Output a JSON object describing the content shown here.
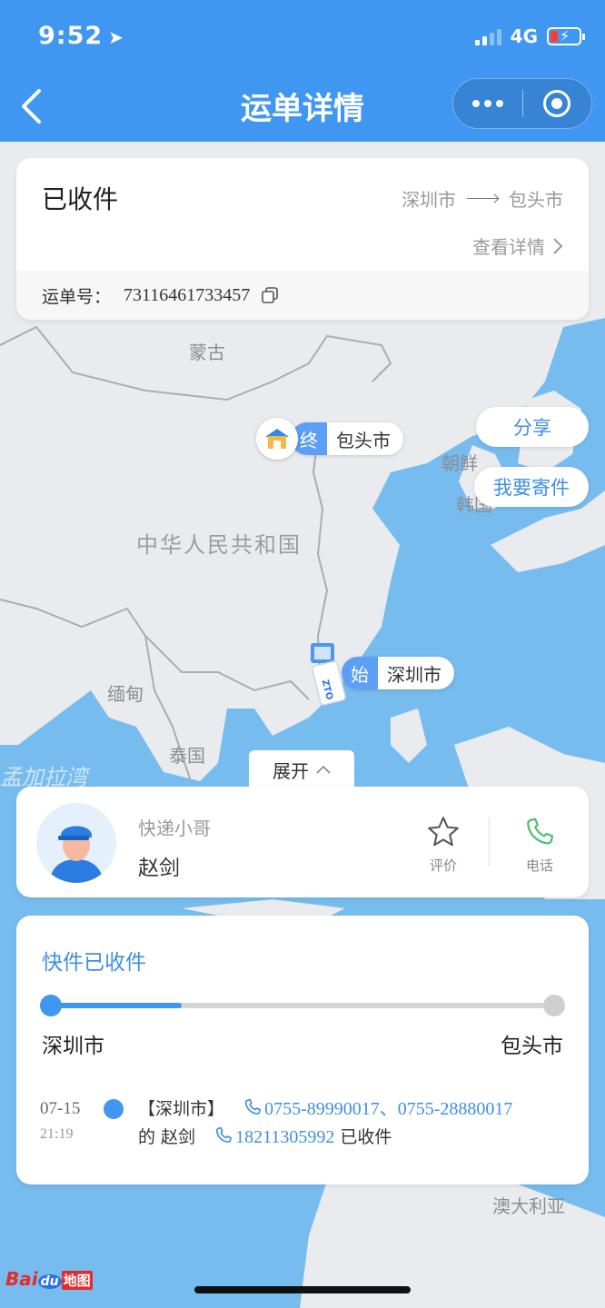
{
  "status_bar": {
    "time": "9:52",
    "network": "4G"
  },
  "nav": {
    "title": "运单详情"
  },
  "order": {
    "status": "已收件",
    "origin": "深圳市",
    "destination": "包头市",
    "detail_link": "查看详情",
    "waybill_label": "运单号：",
    "waybill_number": "73116461733457"
  },
  "map": {
    "labels": {
      "mongolia": "蒙古",
      "china": "中华人民共和国",
      "myanmar": "缅甸",
      "thailand": "泰国",
      "korea_north": "朝鲜",
      "korea_south": "韩国",
      "bay": "孟加拉湾",
      "australia": "澳大利亚"
    },
    "end_marker": {
      "tag": "终",
      "city": "包头市"
    },
    "start_marker": {
      "tag": "始",
      "city": "深圳市"
    },
    "share_button": "分享",
    "send_button": "我要寄件",
    "expand_label": "展开",
    "logo_text": "Bai",
    "logo_du": "du",
    "logo_map": "地图"
  },
  "courier": {
    "role": "快递小哥",
    "name": "赵剑",
    "rate_label": "评价",
    "call_label": "电话"
  },
  "progress": {
    "title": "快件已收件",
    "from": "深圳市",
    "to": "包头市",
    "fraction": 0.26,
    "event": {
      "date": "07-15",
      "time": "21:19",
      "prefix": "【深圳市】",
      "phones_1": "0755-89990017、0755-28880017",
      "middle": "的 赵剑",
      "phone_2": "18211305992",
      "suffix": "已收件"
    }
  },
  "colors": {
    "primary": "#3f97f2",
    "link": "#3f8ee6",
    "sea": "#77bcee",
    "land": "#e9ebee",
    "phone_green": "#4cbf6d"
  }
}
